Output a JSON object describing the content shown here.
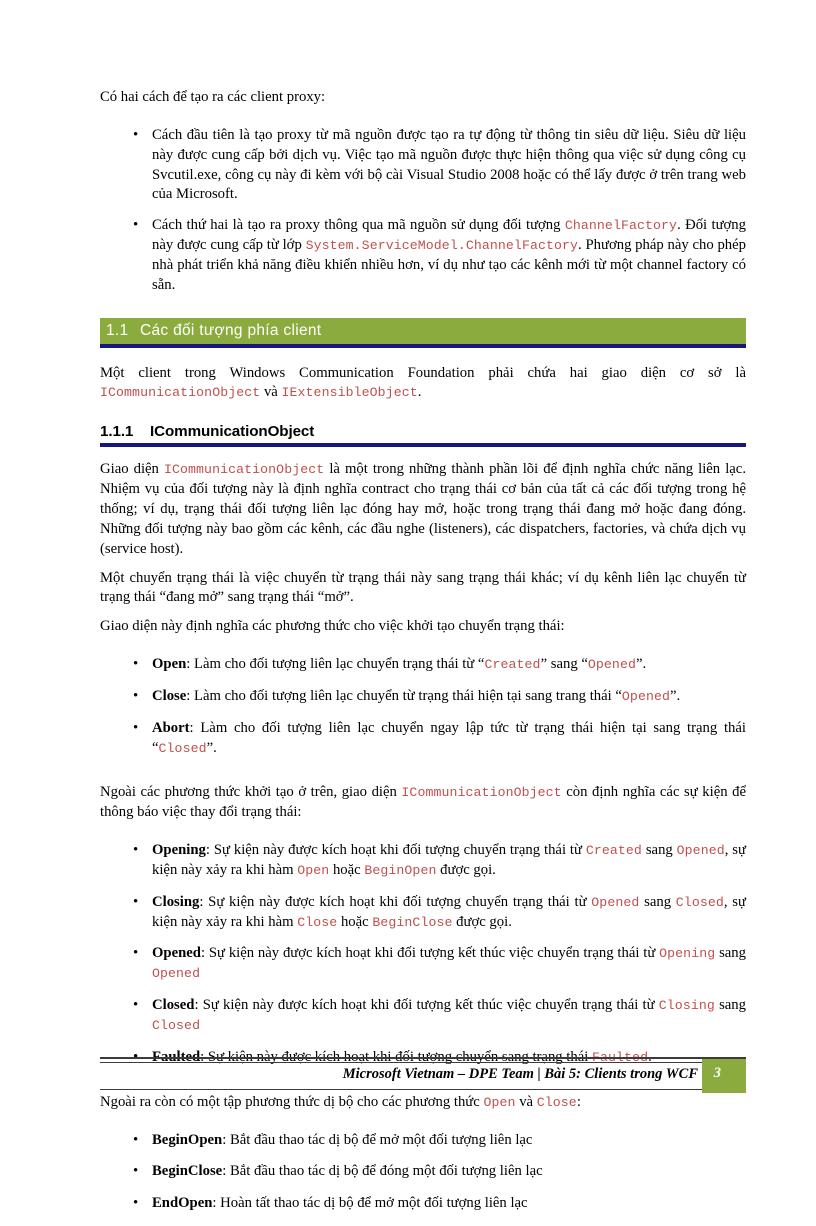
{
  "document": {
    "language": "vi",
    "colors": {
      "heading_band_green": "#8cab3e",
      "heading_rule_navy": "#17177f",
      "code_red": "#c0504d",
      "body_text": "#000000",
      "footer_rule": "#3b3b3b"
    }
  },
  "intro": {
    "lead": "Có hai cách để tạo ra các client proxy:",
    "bullets": [
      {
        "parts": [
          {
            "t": "Cách đầu tiên là tạo proxy từ mã nguồn được tạo ra tự động từ thông tin siêu dữ liệu. Siêu dữ liệu này được cung cấp bởi dịch vụ. Việc tạo mã nguồn được thực hiện thông qua việc sử dụng công cụ Svcutil.exe, công cụ này đi kèm với bộ cài Visual Studio 2008 hoặc có thể lấy được ở trên trang web của Microsoft.",
            "s": "normal"
          }
        ]
      },
      {
        "parts": [
          {
            "t": "Cách thứ hai là tạo ra proxy thông qua mã nguồn sử dụng đối tượng ",
            "s": "normal"
          },
          {
            "t": "ChannelFactory",
            "s": "code"
          },
          {
            "t": ". Đối tượng này được cung cấp từ lớp ",
            "s": "normal"
          },
          {
            "t": "System.ServiceModel.ChannelFactory",
            "s": "code"
          },
          {
            "t": ". Phương pháp này cho phép nhà phát triển khả năng điều khiển nhiều hơn, ví dụ như tạo các kênh mới từ một channel factory có sẵn.",
            "s": "normal"
          }
        ]
      }
    ]
  },
  "section": {
    "number": "1.1",
    "title": "Các đối tượng phía client",
    "intro": {
      "parts": [
        {
          "t": "Một client trong Windows Communication Foundation phải chứa hai giao diện cơ sở là ",
          "s": "normal"
        },
        {
          "t": "ICommunicationObject",
          "s": "code"
        },
        {
          "t": " và ",
          "s": "normal"
        },
        {
          "t": "IExtensibleObject",
          "s": "code"
        },
        {
          "t": ".",
          "s": "normal"
        }
      ]
    }
  },
  "subsection": {
    "number": "1.1.1",
    "title": "ICommunicationObject",
    "paragraphs": [
      {
        "parts": [
          {
            "t": "Giao diện ",
            "s": "normal"
          },
          {
            "t": "ICommunicationObject",
            "s": "code"
          },
          {
            "t": " là một trong những thành phần lõi để định nghĩa chức năng liên lạc. Nhiệm vụ của đối tượng này là định nghĩa contract cho trạng thái cơ bản của tất cả các đối tượng trong hệ thống; ví dụ, trạng thái đối tượng liên lạc đóng hay mở, hoặc trong trạng thái đang mở hoặc đang đóng. Những đối tượng này bao gồm các kênh, các đầu nghe (listeners), các dispatchers, factories, và chứa dịch vụ (service host).",
            "s": "normal"
          }
        ]
      },
      {
        "parts": [
          {
            "t": "Một chuyển trạng thái là việc chuyển từ trạng thái này sang trạng thái khác; ví dụ kênh liên lạc chuyển từ trạng thái “đang mở” sang trạng thái “mở”.",
            "s": "normal"
          }
        ]
      },
      {
        "parts": [
          {
            "t": "Giao diện này định nghĩa các phương thức cho việc khởi tạo chuyển trạng thái:",
            "s": "normal"
          }
        ]
      }
    ],
    "method_bullets": [
      {
        "parts": [
          {
            "t": "Open",
            "s": "bold"
          },
          {
            "t": ": Làm cho đối tượng liên lạc chuyển trạng thái từ “",
            "s": "normal"
          },
          {
            "t": "Created",
            "s": "code"
          },
          {
            "t": "” sang “",
            "s": "normal"
          },
          {
            "t": "Opened",
            "s": "code"
          },
          {
            "t": "”.",
            "s": "normal"
          }
        ]
      },
      {
        "parts": [
          {
            "t": "Close",
            "s": "bold"
          },
          {
            "t": ": Làm cho đối tượng liên lạc chuyển từ trạng thái hiện tại sang trang thái “",
            "s": "normal"
          },
          {
            "t": "Opened",
            "s": "code"
          },
          {
            "t": "”.",
            "s": "normal"
          }
        ]
      },
      {
        "parts": [
          {
            "t": "Abort",
            "s": "bold"
          },
          {
            "t": ": Làm cho đối tượng liên lạc chuyển ngay lập tức từ trạng thái hiện tại sang trạng thái “",
            "s": "normal"
          },
          {
            "t": "Closed",
            "s": "code"
          },
          {
            "t": "”.",
            "s": "normal"
          }
        ]
      }
    ],
    "events_intro": {
      "parts": [
        {
          "t": "Ngoài các phương thức khởi tạo ở trên, giao diện ",
          "s": "normal"
        },
        {
          "t": "ICommunicationObject",
          "s": "code"
        },
        {
          "t": " còn định nghĩa các sự kiện để thông báo việc thay đổi trạng thái:",
          "s": "normal"
        }
      ]
    },
    "event_bullets": [
      {
        "parts": [
          {
            "t": "Opening",
            "s": "bold"
          },
          {
            "t": ": Sự kiện này được kích hoạt khi đối tượng chuyển trạng thái từ ",
            "s": "normal"
          },
          {
            "t": "Created",
            "s": "code"
          },
          {
            "t": " sang ",
            "s": "normal"
          },
          {
            "t": "Opened",
            "s": "code"
          },
          {
            "t": ", sự kiện này xảy ra khi hàm ",
            "s": "normal"
          },
          {
            "t": "Open",
            "s": "code"
          },
          {
            "t": " hoặc ",
            "s": "normal"
          },
          {
            "t": "BeginOpen",
            "s": "code"
          },
          {
            "t": " được gọi.",
            "s": "normal"
          }
        ]
      },
      {
        "parts": [
          {
            "t": "Closing",
            "s": "bold"
          },
          {
            "t": ": Sự kiện này được kích hoạt khi đối tượng chuyển trạng thái từ ",
            "s": "normal"
          },
          {
            "t": "Opened",
            "s": "code"
          },
          {
            "t": " sang ",
            "s": "normal"
          },
          {
            "t": "Closed",
            "s": "code"
          },
          {
            "t": ", sự kiện này xảy ra khi hàm ",
            "s": "normal"
          },
          {
            "t": "Close",
            "s": "code"
          },
          {
            "t": " hoặc ",
            "s": "normal"
          },
          {
            "t": "BeginClose",
            "s": "code"
          },
          {
            "t": " được gọi.",
            "s": "normal"
          }
        ]
      },
      {
        "parts": [
          {
            "t": "Opened",
            "s": "bold"
          },
          {
            "t": ": Sự kiện này được kích hoạt khi đối tượng kết thúc việc chuyển trạng thái từ ",
            "s": "normal"
          },
          {
            "t": "Opening",
            "s": "code"
          },
          {
            "t": " sang ",
            "s": "normal"
          },
          {
            "t": "Opened",
            "s": "code"
          }
        ]
      },
      {
        "parts": [
          {
            "t": "Closed",
            "s": "bold"
          },
          {
            "t": ": Sự kiện này được kích hoạt khi đối tượng kết thúc việc chuyển trạng thái từ ",
            "s": "normal"
          },
          {
            "t": "Closing",
            "s": "code"
          },
          {
            "t": " sang ",
            "s": "normal"
          },
          {
            "t": "Closed",
            "s": "code"
          }
        ]
      },
      {
        "parts": [
          {
            "t": "Faulted",
            "s": "bold"
          },
          {
            "t": ": Sự kiện này được kích hoạt khi đối tượng chuyển sang trạng thái ",
            "s": "normal"
          },
          {
            "t": "Faulted",
            "s": "code"
          },
          {
            "t": ".",
            "s": "normal"
          }
        ]
      }
    ],
    "async_intro": {
      "parts": [
        {
          "t": "Ngoài ra còn có một tập phương thức dị bộ cho các phương thức ",
          "s": "normal"
        },
        {
          "t": "Open",
          "s": "code"
        },
        {
          "t": " và ",
          "s": "normal"
        },
        {
          "t": "Close",
          "s": "code"
        },
        {
          "t": ":",
          "s": "normal"
        }
      ]
    },
    "async_bullets": [
      {
        "parts": [
          {
            "t": "BeginOpen",
            "s": "bold"
          },
          {
            "t": ": Bắt đầu thao tác dị bộ để mở một đối tượng liên lạc",
            "s": "normal"
          }
        ]
      },
      {
        "parts": [
          {
            "t": "BeginClose",
            "s": "bold"
          },
          {
            "t": ": Bắt đầu thao tác dị bộ để đóng một đối tượng liên lạc",
            "s": "normal"
          }
        ]
      },
      {
        "parts": [
          {
            "t": "EndOpen",
            "s": "bold"
          },
          {
            "t": ": Hoàn tất thao tác dị bộ để mở một đối tượng liên lạc",
            "s": "normal"
          }
        ]
      }
    ]
  },
  "footer": {
    "text": "Microsoft Vietnam – DPE Team | Bài 5: Clients trong WCF",
    "page_number": "3"
  }
}
